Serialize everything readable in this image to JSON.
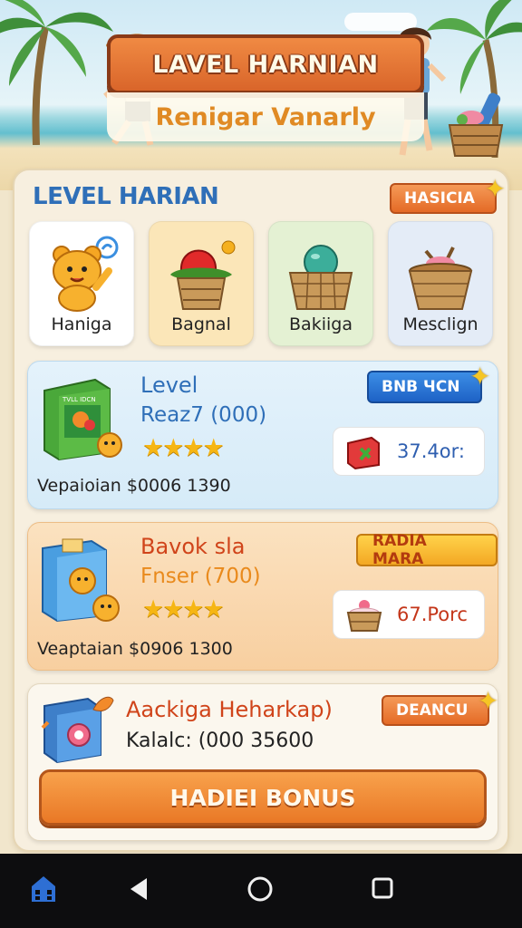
{
  "header": {
    "banner_title": "LAVEL HARNIAN",
    "banner_subtitle": "Renigar Vanarly"
  },
  "panel": {
    "title": "LEVEL HARIAN",
    "corner_badge": "HASICIA"
  },
  "categories": [
    {
      "label": "Haniga",
      "icon": "bear-icon",
      "bg": "#ffffff"
    },
    {
      "label": "Bagnal",
      "icon": "fruit-basket-icon",
      "bg": "#fbe6b8"
    },
    {
      "label": "Bakiiga",
      "icon": "ball-basket-icon",
      "bg": "#e4f1d3"
    },
    {
      "label": "Mesclign",
      "icon": "basket-icon",
      "bg": "#e4ecf7"
    }
  ],
  "cards": [
    {
      "badge": "BNB ЧCN",
      "name": "Level",
      "subtitle": "Reaz7 (000)",
      "rating": 4,
      "footer": "Vepaioian $0006 1390",
      "price": "37.4or:",
      "box_label": "TVLL IDCN"
    },
    {
      "badge": "RADIA MARA",
      "name": "Bavok sla",
      "subtitle": "Fnser  (700)",
      "rating": 4,
      "footer": "Veaptaian $0906 1300",
      "price": "67.Porc"
    },
    {
      "badge": "DEANCU",
      "name": "Aackiga Heharkap)",
      "subtitle": "Kalalc: (000 35600",
      "button": "HADIEI BONUS"
    }
  ],
  "colors": {
    "title_blue": "#2f6fb8",
    "accent_orange": "#e97826",
    "star_gold": "#f6b614",
    "card2_name_red": "#d0441a",
    "card2_sub_orange": "#e98a1c"
  },
  "navbar": {
    "items": [
      "home-icon",
      "back-icon",
      "home-circle-icon",
      "recents-icon"
    ]
  }
}
